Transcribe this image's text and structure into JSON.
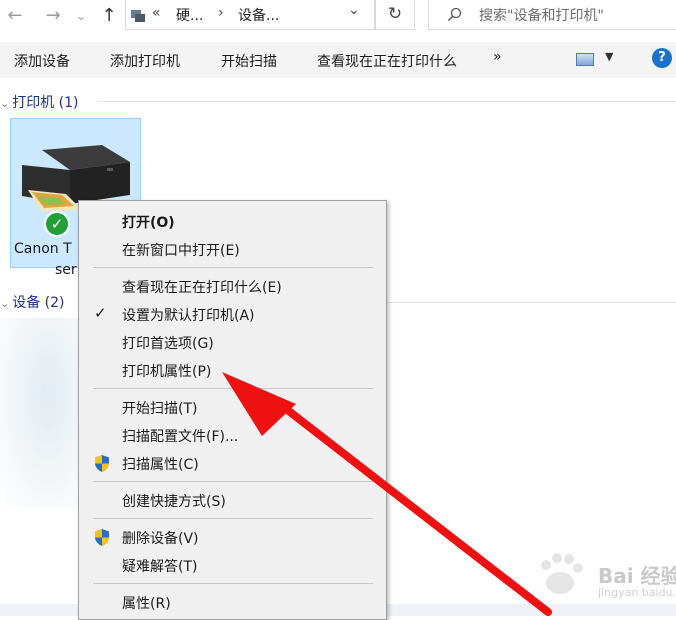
{
  "nav": {
    "breadcrumb_overflow": "«",
    "crumbs": [
      "硬...",
      "设备..."
    ],
    "crumb_separator": "›",
    "search_placeholder": "搜索\"设备和打印机\""
  },
  "toolbar": {
    "items": [
      "添加设备",
      "添加打印机",
      "开始扫描",
      "查看现在正在打印什么"
    ],
    "more": "»"
  },
  "groups": {
    "printers_header": "打印机 (1)",
    "devices_header": "设备 (2)"
  },
  "printer": {
    "name_line1": "Canon T",
    "name_line2": "seri"
  },
  "context_menu": {
    "items": [
      {
        "label": "打开(O)"
      },
      {
        "label": "在新窗口中打开(E)"
      },
      {
        "label": "查看现在正在打印什么(E)"
      },
      {
        "label": "设置为默认打印机(A)"
      },
      {
        "label": "打印首选项(G)"
      },
      {
        "label": "打印机属性(P)"
      },
      {
        "label": "开始扫描(T)"
      },
      {
        "label": "扫描配置文件(F)..."
      },
      {
        "label": "扫描属性(C)"
      },
      {
        "label": "创建快捷方式(S)"
      },
      {
        "label": "删除设备(V)"
      },
      {
        "label": "疑难解答(T)"
      },
      {
        "label": "属性(R)"
      }
    ]
  },
  "watermark": {
    "brand": "Bai",
    "brand_suffix": "经验",
    "sub": "jingyan.baidu.com"
  },
  "colors": {
    "accent": "#1e3287",
    "selection": "#cce8ff",
    "arrow": "#ee1111",
    "check": "#21a03a"
  }
}
